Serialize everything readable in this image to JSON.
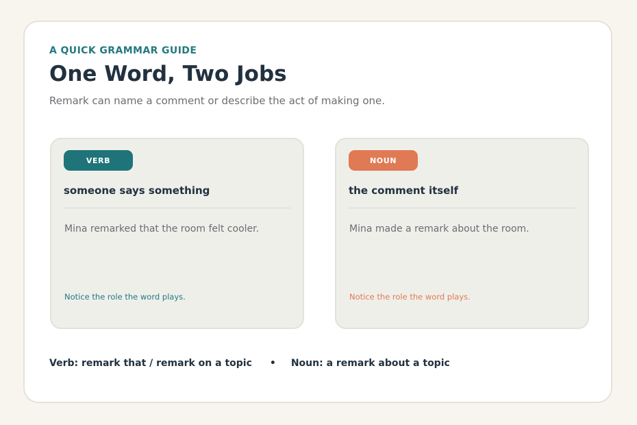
{
  "header": {
    "eyebrow": "A QUICK GRAMMAR GUIDE",
    "title": "One Word, Two Jobs",
    "subtitle": "Remark can name a comment or describe the act of making one."
  },
  "panels": [
    {
      "badge": "VERB",
      "heading": "someone says something",
      "example": "Mina remarked that the room felt cooler.",
      "note": "Notice the role the word plays.",
      "accent": "#1e7479"
    },
    {
      "badge": "NOUN",
      "heading": "the comment itself",
      "example": "Mina made a remark about the room.",
      "note": "Notice the role the word plays.",
      "accent": "#e07a54"
    }
  ],
  "footer": {
    "verb_text": "Verb: remark that / remark on a topic",
    "separator": "•",
    "noun_text": "Noun: a remark about a topic"
  },
  "colors": {
    "background": "#f8f4ee",
    "card": "#ffffff",
    "panel": "#efefea",
    "text_dark": "#22313f",
    "text_muted": "#6a6d72",
    "teal": "#237a80",
    "orange": "#e07a54"
  }
}
